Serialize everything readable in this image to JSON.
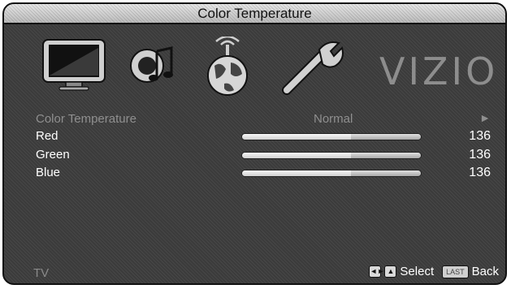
{
  "title": "Color Temperature",
  "menu_icons": [
    "tv-icon",
    "audio-icon",
    "network-icon",
    "settings-icon"
  ],
  "brand": "VIZIO",
  "setting": {
    "label": "Color Temperature",
    "value": "Normal"
  },
  "sliders": [
    {
      "label": "Red",
      "value": "136",
      "level": 0.61
    },
    {
      "label": "Green",
      "value": "136",
      "level": 0.61
    },
    {
      "label": "Blue",
      "value": "136",
      "level": 0.61
    }
  ],
  "footer": {
    "input": "TV",
    "select_label": "Select",
    "last_key": "LAST",
    "back_label": "Back"
  }
}
